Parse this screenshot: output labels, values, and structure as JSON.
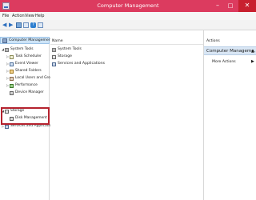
{
  "window": {
    "title": "Computer Management",
    "controls": {
      "minimize": "–",
      "maximize": "□",
      "close": "✕"
    }
  },
  "menu": {
    "file": "File",
    "action": "Action",
    "view": "View",
    "help": "Help"
  },
  "toolbar": {
    "back_glyph": "◀",
    "forward_glyph": "▶",
    "help_glyph": "?",
    "icons": [
      "back-icon",
      "forward-icon",
      "up-level-icon",
      "show-hide-tree-icon",
      "help-icon",
      "list-icon"
    ]
  },
  "tree": {
    "root": "Computer Management (Local",
    "items": [
      {
        "label": "System Tools",
        "expander": "◢",
        "icon": "tools-icon"
      },
      {
        "label": "Task Scheduler",
        "expander": "▷",
        "icon": "task-scheduler-icon"
      },
      {
        "label": "Event Viewer",
        "expander": "▷",
        "icon": "event-viewer-icon"
      },
      {
        "label": "Shared Folders",
        "expander": "▷",
        "icon": "shared-folders-icon"
      },
      {
        "label": "Local Users and Groups",
        "expander": "▷",
        "icon": "users-icon"
      },
      {
        "label": "Performance",
        "expander": "▷",
        "icon": "performance-icon"
      },
      {
        "label": "Device Manager",
        "expander": "",
        "icon": "device-manager-icon"
      },
      {
        "label": "Storage",
        "expander": "◢",
        "icon": "storage-icon"
      },
      {
        "label": "Disk Management",
        "expander": "",
        "icon": "disk-management-icon"
      },
      {
        "label": "Services and Applications",
        "expander": "▷",
        "icon": "services-icon"
      }
    ]
  },
  "content": {
    "column_name": "Name",
    "rows": [
      {
        "label": "System Tools",
        "icon": "tools-icon"
      },
      {
        "label": "Storage",
        "icon": "storage-icon"
      },
      {
        "label": "Services and Applications",
        "icon": "services-icon"
      }
    ]
  },
  "actions": {
    "header": "Actions",
    "section": "Computer Manageme...",
    "section_arrow": "▲",
    "more": "More Actions",
    "more_arrow": "▶"
  },
  "colors": {
    "titlebar": "#dc3b5f",
    "close_button": "#c8202f",
    "selection": "#cde4f7",
    "highlight_box": "#b5222e"
  }
}
